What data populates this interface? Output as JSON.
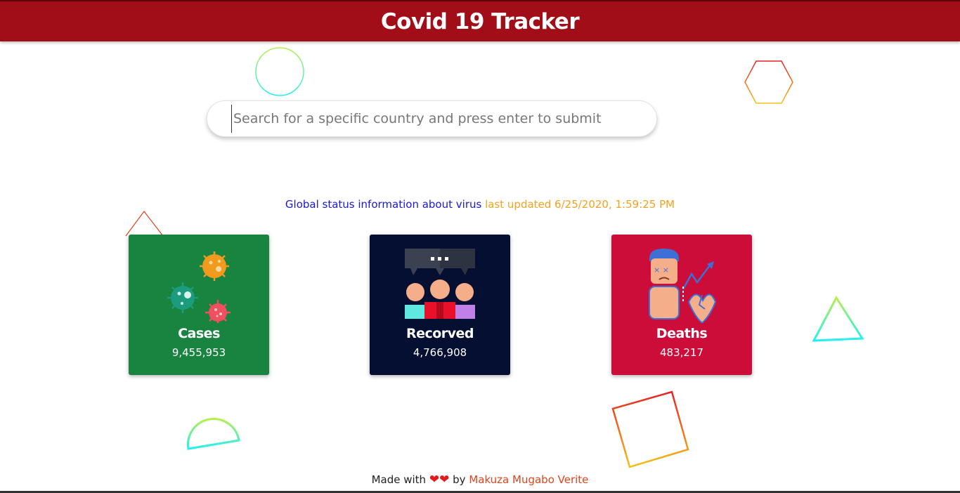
{
  "header": {
    "title": "Covid 19 Tracker"
  },
  "search": {
    "placeholder": "Search for a specific country and press enter to submit",
    "value": ""
  },
  "status": {
    "label": "Global status information about virus",
    "updated": "last updated 6/25/2020, 1:59:25 PM"
  },
  "cards": [
    {
      "title": "Cases",
      "value": "9,455,953",
      "color": "#198440",
      "icon": "virus-icon"
    },
    {
      "title": "Recorved",
      "value": "4,766,908",
      "color": "#040f31",
      "icon": "people-chat-icon"
    },
    {
      "title": "Deaths",
      "value": "483,217",
      "color": "#cc0d3a",
      "icon": "sick-person-heart-icon"
    }
  ],
  "footer": {
    "made_with": "Made with",
    "hearts": "❤❤",
    "by": "by",
    "author": "Makuza Mugabo Verite"
  },
  "colors": {
    "header": "#a10e17",
    "status_blue": "#1a18d8",
    "status_orange": "#f3a21f",
    "author": "#e0441e"
  }
}
